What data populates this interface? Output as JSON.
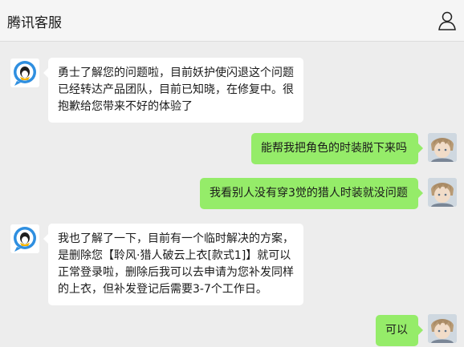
{
  "header": {
    "title": "腾讯客服",
    "profile_icon": "user-profile-icon"
  },
  "colors": {
    "background": "#ededed",
    "incoming_bubble": "#ffffff",
    "outgoing_bubble": "#95ec69",
    "brand_blue": "#2f8fe0"
  },
  "messages": [
    {
      "sender": "service",
      "text": "勇士了解您的问题啦，目前妖护使闪退这个问题已经转达产品团队，目前已知晓，在修复中。很抱歉给您带来不好的体验了"
    },
    {
      "sender": "user",
      "text": "能帮我把角色的时装脱下来吗"
    },
    {
      "sender": "user",
      "text": "我看别人没有穿3觉的猎人时装就没问题"
    },
    {
      "sender": "service",
      "text": "我也了解了一下，目前有一个临时解决的方案，是删除您【聆风·猎人破云上衣[款式1]】就可以正常登录啦，删除后我可以去申请为您补发同样的上衣，但补发登记后需要3-7个工作日。"
    },
    {
      "sender": "user",
      "text": "可以"
    }
  ]
}
